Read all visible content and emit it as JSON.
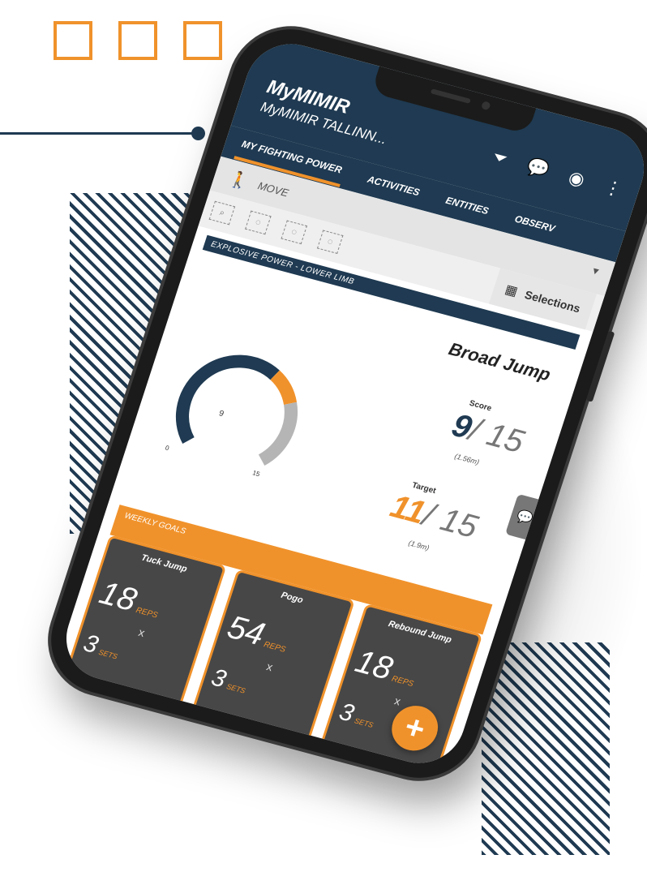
{
  "app": {
    "title": "MyMIMIR",
    "subtitle": "MyMIMIR TALLINN...",
    "icons": [
      "filter-icon",
      "chat-icon",
      "eye-icon",
      "more-vertical-icon"
    ]
  },
  "tabs": [
    {
      "label": "MY FIGHTING POWER",
      "active": true
    },
    {
      "label": "ACTIVITIES",
      "active": false
    },
    {
      "label": "ENTITIES",
      "active": false
    },
    {
      "label": "OBSERV",
      "active": false
    }
  ],
  "move": {
    "label": "MOVE"
  },
  "filters": {
    "selections_label": "Selections"
  },
  "section": {
    "label": "EXPLOSIVE POWER - LOWER LIMB"
  },
  "metric": {
    "name": "Broad Jump",
    "score_label": "Score",
    "score": "9",
    "score_denom": "/ 15",
    "score_sub": "(1.56m)",
    "target_label": "Target",
    "target": "11",
    "target_denom": "/ 15",
    "target_sub": "(1.9m)",
    "gauge": {
      "min_label": "0",
      "max_label": "15",
      "value_label": "9",
      "value": 9,
      "target": 11,
      "max": 15
    }
  },
  "weekly_goals": {
    "label": "WEEKLY GOALS",
    "cards": [
      {
        "title": "Tuck Jump",
        "reps": "18",
        "reps_unit": "REPS",
        "times": "x",
        "sets": "3",
        "sets_unit": "SETS"
      },
      {
        "title": "Pogo",
        "reps": "54",
        "reps_unit": "REPS",
        "times": "x",
        "sets": "3",
        "sets_unit": "SETS"
      },
      {
        "title": "Rebound Jump",
        "reps": "18",
        "reps_unit": "REPS",
        "times": "x",
        "sets": "3",
        "sets_unit": "SETS"
      }
    ]
  },
  "fab": {
    "label": "+"
  },
  "colors": {
    "navy": "#1f3a52",
    "orange": "#f0922b",
    "card": "#474747",
    "gauge_gray": "#b5b5b5"
  }
}
